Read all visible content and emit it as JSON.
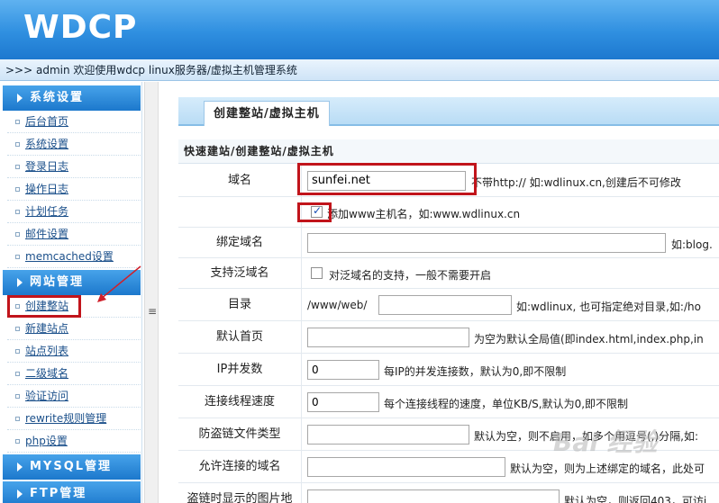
{
  "header": {
    "logo": "WDCP"
  },
  "infobar": {
    "text": ">>> admin 欢迎使用wdcp linux服务器/虚拟主机管理系统"
  },
  "sidebar": {
    "sections": [
      {
        "title": "系统设置",
        "items": [
          "后台首页",
          "系统设置",
          "登录日志",
          "操作日志",
          "计划任务",
          "邮件设置",
          "memcached设置"
        ]
      },
      {
        "title": "网站管理",
        "items": [
          "创建整站",
          "新建站点",
          "站点列表",
          "二级域名",
          "验证访问",
          "rewrite规则管理",
          "php设置"
        ]
      },
      {
        "title": "MYSQL管理",
        "items": []
      },
      {
        "title": "FTP管理",
        "items": []
      }
    ]
  },
  "splitter": {
    "grip": "≡"
  },
  "main": {
    "tab": "创建整站/虚拟主机",
    "form_title": "快速建站/创建整站/虚拟主机",
    "rows": [
      {
        "label": "域名",
        "value": "sunfei.net",
        "hint": "不带http:// 如:wdlinux.cn,创建后不可修改"
      },
      {
        "label": "",
        "checkbox_checked": true,
        "hint": "添加www主机名，如:www.wdlinux.cn"
      },
      {
        "label": "绑定域名",
        "value": "",
        "hint": "如:blog."
      },
      {
        "label": "支持泛域名",
        "checkbox_checked": false,
        "hint": "对泛域名的支持，一般不需要开启"
      },
      {
        "label": "目录",
        "prefix": "/www/web/",
        "value": "",
        "hint": "如:wdlinux, 也可指定绝对目录,如:/ho"
      },
      {
        "label": "默认首页",
        "value": "",
        "hint": "为空为默认全局值(即index.html,index.php,in"
      },
      {
        "label": "IP并发数",
        "value": "0",
        "hint": "每IP的并发连接数，默认为0,即不限制"
      },
      {
        "label": "连接线程速度",
        "value": "0",
        "hint": "每个连接线程的速度，单位KB/S,默认为0,即不限制"
      },
      {
        "label": "防盗链文件类型",
        "value": "",
        "hint": "默认为空，则不启用，如多个用逗号(,)分隔,如:"
      },
      {
        "label": "允许连接的域名",
        "value": "",
        "hint": "默认为空，则为上述绑定的域名，此处可"
      },
      {
        "label": "盗链时显示的图片地",
        "value": "",
        "hint": "默认为空，则返回403，可访i"
      }
    ]
  },
  "watermark": "Bai 经验",
  "colors": {
    "header_blue": "#2f8fe0",
    "highlight_red": "#c1141b",
    "link_blue": "#1a4f8a"
  }
}
